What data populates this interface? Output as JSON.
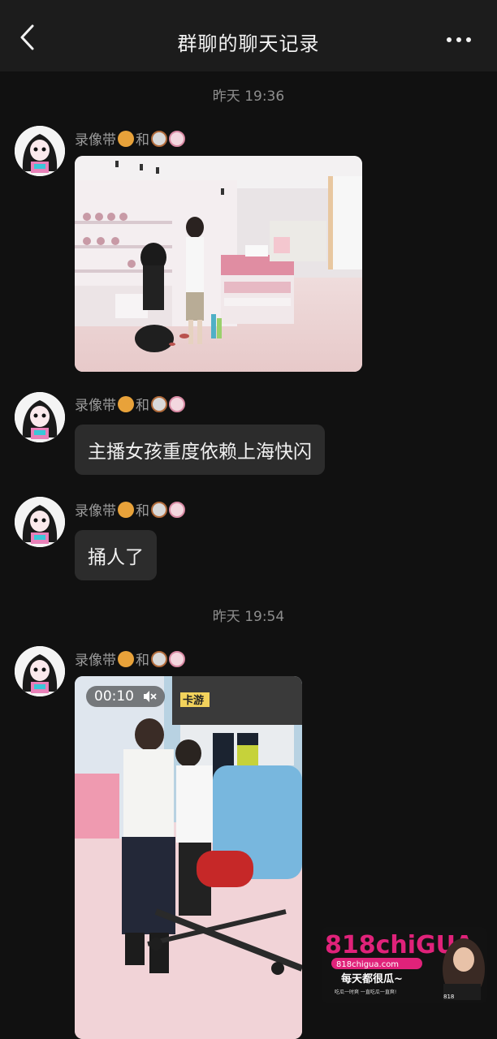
{
  "header": {
    "title": "群聊的聊天记录"
  },
  "messages": [
    {
      "timestamp": "昨天 19:36"
    },
    {
      "sender": "录像带🍔和🍜🍥",
      "type": "image"
    },
    {
      "sender": "录像带🍔和🍜🍥",
      "type": "text",
      "text": "主播女孩重度依赖上海快闪"
    },
    {
      "sender": "录像带🍔和🍜🍥",
      "type": "text",
      "text": "捅人了"
    },
    {
      "timestamp": "昨天 19:54"
    },
    {
      "sender": "录像带🍔和🍜🍥",
      "type": "video",
      "duration": "00:10"
    }
  ],
  "sender_name": "录像带",
  "sender_conj": "和",
  "image1": {
    "store_sign": ""
  },
  "video1": {
    "duration": "00:10",
    "sign_text": "卡游",
    "muted": true
  },
  "watermark": {
    "brand": "818chiGUA",
    "url": "818chigua.com",
    "slogan": "每天都很瓜~",
    "tagline": "吃瓜一时爽 一直吃瓜一直爽!",
    "badge": "818"
  },
  "colors": {
    "background": "#111111",
    "topbar": "#1c1c1c",
    "bubble": "#2c2c2c",
    "brand_pink": "#e0227a"
  }
}
